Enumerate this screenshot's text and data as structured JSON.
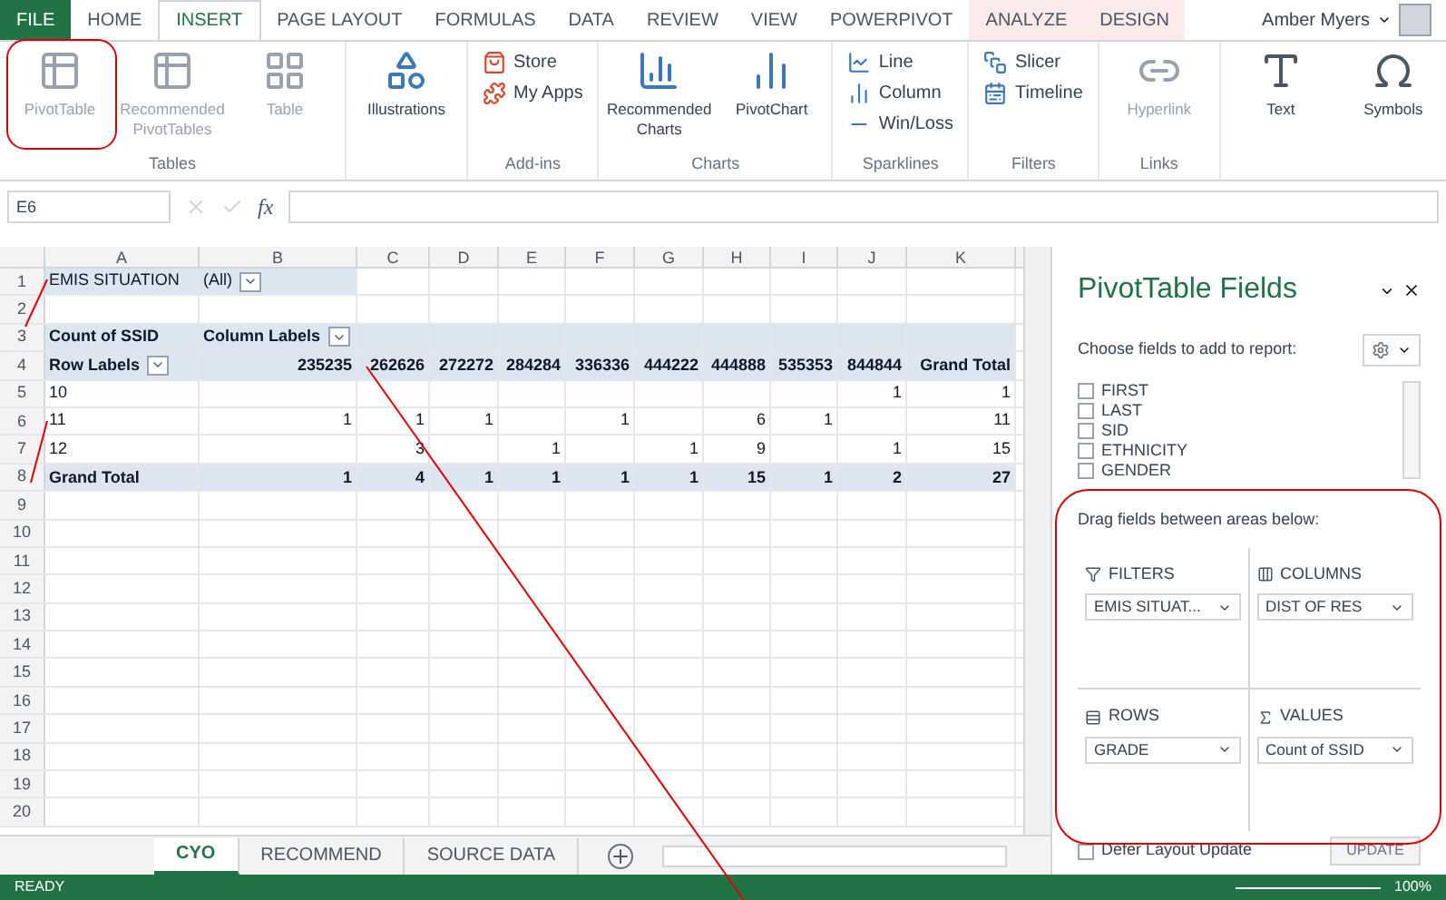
{
  "ribbon_tabs": [
    {
      "label": "FILE",
      "kind": "file",
      "selected": false
    },
    {
      "label": "HOME",
      "kind": "tab",
      "selected": false
    },
    {
      "label": "INSERT",
      "kind": "tab",
      "selected": true
    },
    {
      "label": "PAGE LAYOUT",
      "kind": "tab",
      "selected": false
    },
    {
      "label": "FORMULAS",
      "kind": "tab",
      "selected": false
    },
    {
      "label": "DATA",
      "kind": "tab",
      "selected": false
    },
    {
      "label": "REVIEW",
      "kind": "tab",
      "selected": false
    },
    {
      "label": "VIEW",
      "kind": "tab",
      "selected": false
    },
    {
      "label": "POWERPIVOT",
      "kind": "tab",
      "selected": false
    },
    {
      "label": "ANALYZE",
      "kind": "context",
      "selected": false
    },
    {
      "label": "DESIGN",
      "kind": "context",
      "selected": false
    }
  ],
  "user": {
    "name": "Amber Myers"
  },
  "ribbon_groups": [
    {
      "label": "Tables",
      "buttons": [
        {
          "label": "PivotTable",
          "disabled": true
        },
        {
          "label": "Recommended PivotTables",
          "disabled": true
        },
        {
          "label": "Table",
          "disabled": true
        }
      ]
    },
    {
      "buttons": [
        {
          "label": "Illustrations",
          "disabled": false
        }
      ]
    },
    {
      "label": "Add-ins",
      "buttons": [
        {
          "label": "Store",
          "disabled": false
        },
        {
          "label": "My Apps",
          "disabled": false
        }
      ]
    },
    {
      "label": "Charts",
      "buttons": [
        {
          "label": "Recommended Charts",
          "disabled": false
        },
        {
          "label": "PivotChart",
          "disabled": false
        }
      ]
    },
    {
      "label": "Sparklines",
      "buttons": [
        {
          "label": "Line",
          "disabled": false
        },
        {
          "label": "Column",
          "disabled": false
        },
        {
          "label": "Win/Loss",
          "disabled": false
        }
      ]
    },
    {
      "label": "Filters",
      "buttons": [
        {
          "label": "Slicer",
          "disabled": false
        },
        {
          "label": "Timeline",
          "disabled": false
        }
      ]
    },
    {
      "label": "Links",
      "buttons": [
        {
          "label": "Hyperlink",
          "disabled": true
        }
      ]
    },
    {
      "buttons": [
        {
          "label": "Text",
          "disabled": false
        },
        {
          "label": "Symbols",
          "disabled": false
        }
      ]
    }
  ],
  "formula_bar": {
    "name_box": "E6",
    "function_label": "fx"
  },
  "columns": [
    "A",
    "B",
    "C",
    "D",
    "E",
    "F",
    "G",
    "H",
    "I",
    "J",
    "K"
  ],
  "rows": [
    {
      "number": "1",
      "kind": "filter",
      "cells": [
        {
          "text": "EMIS SITUATION"
        },
        {
          "text": "(All)",
          "dropdown": true
        },
        null,
        null,
        null,
        null,
        null,
        null,
        null,
        null,
        null
      ]
    },
    {
      "number": "2",
      "kind": "blank",
      "cells": []
    },
    {
      "number": "3",
      "kind": "labels",
      "cells": [
        {
          "text": "Count of SSID"
        },
        {
          "text": "Column Labels",
          "dropdown": true
        },
        null,
        null,
        null,
        null,
        null,
        null,
        null,
        null,
        null
      ]
    },
    {
      "number": "4",
      "kind": "header",
      "cells": [
        {
          "text": "Row Labels",
          "dropdown": true
        },
        {
          "text": "235235"
        },
        {
          "text": "262626"
        },
        {
          "text": "272272"
        },
        {
          "text": "284284"
        },
        {
          "text": "336336"
        },
        {
          "text": "444222"
        },
        {
          "text": "444888"
        },
        {
          "text": "535353"
        },
        {
          "text": "844844"
        },
        {
          "text": "Grand Total"
        }
      ]
    },
    {
      "number": "5",
      "kind": "item",
      "cells": [
        {
          "text": "10"
        },
        null,
        null,
        null,
        null,
        null,
        null,
        null,
        null,
        {
          "text": "1"
        },
        {
          "text": "1"
        }
      ]
    },
    {
      "number": "6",
      "kind": "item",
      "cells": [
        {
          "text": "11"
        },
        {
          "text": "1"
        },
        {
          "text": "1"
        },
        {
          "text": "1"
        },
        null,
        {
          "text": "1"
        },
        null,
        {
          "text": "6"
        },
        {
          "text": "1"
        },
        null,
        {
          "text": "11"
        }
      ]
    },
    {
      "number": "7",
      "kind": "item",
      "cells": [
        {
          "text": "12"
        },
        null,
        {
          "text": "3"
        },
        null,
        {
          "text": "1"
        },
        null,
        {
          "text": "1"
        },
        {
          "text": "9"
        },
        null,
        {
          "text": "1"
        },
        {
          "text": "15"
        }
      ]
    },
    {
      "number": "8",
      "kind": "total",
      "cells": [
        {
          "text": "Grand Total"
        },
        {
          "text": "1"
        },
        {
          "text": "4"
        },
        {
          "text": "1"
        },
        {
          "text": "1"
        },
        {
          "text": "1"
        },
        {
          "text": "1"
        },
        {
          "text": "15"
        },
        {
          "text": "1"
        },
        {
          "text": "2"
        },
        {
          "text": "27"
        }
      ]
    },
    {
      "number": "9",
      "kind": "blank",
      "cells": []
    },
    {
      "number": "10",
      "kind": "blank",
      "cells": []
    },
    {
      "number": "11",
      "kind": "blank",
      "cells": []
    },
    {
      "number": "12",
      "kind": "blank",
      "cells": []
    },
    {
      "number": "13",
      "kind": "blank",
      "cells": []
    },
    {
      "number": "14",
      "kind": "blank",
      "cells": []
    },
    {
      "number": "15",
      "kind": "blank",
      "cells": []
    },
    {
      "number": "16",
      "kind": "blank",
      "cells": []
    },
    {
      "number": "17",
      "kind": "blank",
      "cells": []
    },
    {
      "number": "18",
      "kind": "blank",
      "cells": []
    },
    {
      "number": "19",
      "kind": "blank",
      "cells": []
    },
    {
      "number": "20",
      "kind": "blank",
      "cells": []
    }
  ],
  "sheet_tabs": [
    {
      "label": "CYO",
      "selected": true
    },
    {
      "label": "RECOMMEND",
      "selected": false
    },
    {
      "label": "SOURCE DATA",
      "selected": false
    }
  ],
  "pane": {
    "title": "PivotTable Fields",
    "prompt": "Choose fields to add to report:",
    "fields": [
      {
        "label": "FIRST",
        "checked": false
      },
      {
        "label": "LAST",
        "checked": false
      },
      {
        "label": "SID",
        "checked": false
      },
      {
        "label": "ETHNICITY",
        "checked": false
      },
      {
        "label": "GENDER",
        "checked": false
      }
    ],
    "areas_prompt": "Drag fields between areas below:",
    "areas": [
      {
        "label": "FILTERS",
        "field": "EMIS SITUAT..."
      },
      {
        "label": "COLUMNS",
        "field": "DIST OF RES"
      },
      {
        "label": "ROWS",
        "field": "GRADE"
      },
      {
        "label": "VALUES",
        "field": "Count of SSID"
      }
    ],
    "defer": {
      "label": "Defer Layout Update",
      "checked": false
    },
    "update": {
      "label": "UPDATE",
      "disabled": true
    }
  },
  "status_bar": {
    "mode": "READY",
    "zoom": "100%"
  }
}
